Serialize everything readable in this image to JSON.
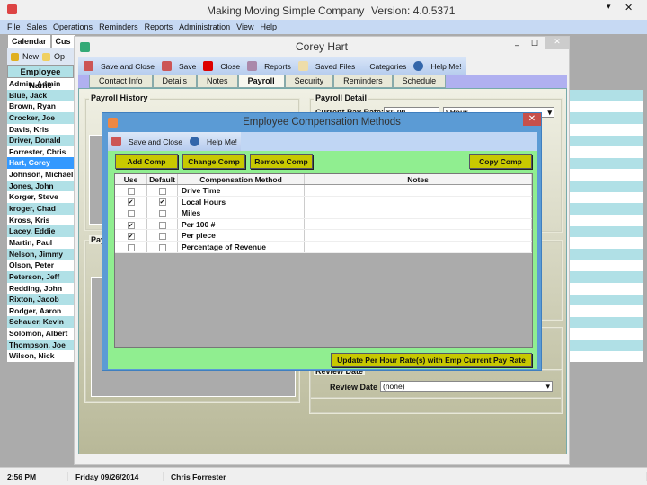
{
  "app": {
    "title": "Making Moving Simple Company",
    "version": "Version: 4.0.5371"
  },
  "menu": [
    "File",
    "Sales",
    "Operations",
    "Reminders",
    "Reports",
    "Administration",
    "View",
    "Help"
  ],
  "doc_tabs": [
    "Calendar",
    "Cus"
  ],
  "main_toolbar": {
    "new": "New",
    "open": "Op"
  },
  "employee_list": {
    "header": "Employee Name",
    "selected": "Hart, Corey",
    "rows": [
      "Admin, Admin",
      "Blue, Jack",
      "Brown, Ryan",
      "Crocker, Joe",
      "Davis, Kris",
      "Driver, Donald",
      "Forrester, Chris",
      "Hart, Corey",
      "Johnson, Michael",
      "Jones, John",
      "Korger, Steve",
      "kroger, Chad",
      "Kross, Kris",
      "Lacey, Eddie",
      "Martin, Paul",
      "Nelson, Jimmy",
      "Olson, Peter",
      "Peterson, Jeff",
      "Redding, John",
      "Rixton, Jacob",
      "Rodger, Aaron",
      "Schauer, Kevin",
      "Solomon, Albert",
      "Thompson, Joe",
      "Wilson, Nick"
    ]
  },
  "employee_window": {
    "title": "Corey Hart",
    "toolbar": {
      "save_close": "Save and Close",
      "save": "Save",
      "close": "Close",
      "reports": "Reports",
      "saved_files": "Saved Files",
      "categories": "Categories",
      "help": "Help Me!"
    },
    "tabs": [
      "Contact Info",
      "Details",
      "Notes",
      "Payroll",
      "Security",
      "Reminders",
      "Schedule"
    ],
    "active_tab": "Payroll",
    "payroll_history_label": "Payroll History",
    "pay_group_label": "Pay",
    "payroll_detail": {
      "label": "Payroll Detail",
      "current_pay_rate_label": "Current Pay Rate:",
      "current_pay_rate": "$0.00",
      "rate_unit": "\\ Hour"
    },
    "review": {
      "group_label": "Review Date",
      "label": "Review Date",
      "value": "(none)"
    }
  },
  "dialog": {
    "title": "Employee Compensation Methods",
    "toolbar": {
      "save_close": "Save and Close",
      "help": "Help Me!"
    },
    "buttons": {
      "add": "Add Comp",
      "change": "Change Comp",
      "remove": "Remove Comp",
      "copy": "Copy Comp",
      "update": "Update Per Hour Rate(s) with Emp Current Pay Rate"
    },
    "columns": [
      "Use",
      "Default",
      "Compensation Method",
      "Notes"
    ],
    "rows": [
      {
        "use": false,
        "default": false,
        "method": "Drive Time",
        "notes": ""
      },
      {
        "use": true,
        "default": true,
        "method": "Local Hours",
        "notes": ""
      },
      {
        "use": false,
        "default": false,
        "method": "Miles",
        "notes": ""
      },
      {
        "use": true,
        "default": false,
        "method": "Per 100 #",
        "notes": ""
      },
      {
        "use": true,
        "default": false,
        "method": "Per piece",
        "notes": ""
      },
      {
        "use": false,
        "default": false,
        "method": "Percentage of Revenue",
        "notes": ""
      }
    ]
  },
  "status": {
    "time": "2:56 PM",
    "date": "Friday 09/26/2014",
    "user": "Chris Forrester"
  },
  "colors": {
    "green_panel": "#90ee90",
    "yellow_button": "#c8c800",
    "list_alt": "#b0e0e6",
    "selected": "#3399ff",
    "dialog_border": "#5b9bd5"
  }
}
